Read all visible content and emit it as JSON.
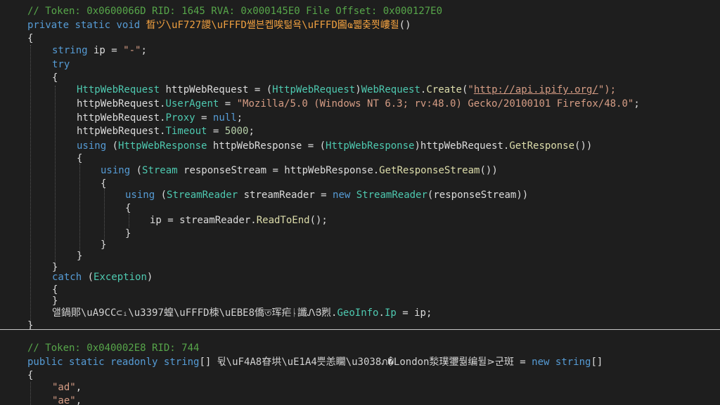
{
  "code": {
    "method_comment": "// Token: 0x0600066D RID: 1645 RVA: 0x000145E0 File Offset: 0x000127E0",
    "kw_private": "private",
    "kw_static": "static",
    "kw_void": "void",
    "method_name": "晳ヅ\\uF727謖\\uFFFD쌜븐켑唉턺욕\\uFFFD\u0011圇ҩ쩳춪쬣嶁죌",
    "method_parens": "()",
    "open_brace": "{",
    "close_brace": "}",
    "kw_string": "string",
    "ip_decl": " ip = ",
    "ip_dash": "\"-\"",
    "semicolon": ";",
    "kw_try": "try",
    "type_httpwebrequest": "HttpWebRequest",
    "var_req": " httpWebRequest = (",
    "cast_close": ")",
    "type_webrequest": "WebRequest",
    "dot": ".",
    "method_create": "Create",
    "open_paren": "(",
    "q_open": "\"",
    "url": "http://api.ipify.org/",
    "q_close_paren_semi": "\");",
    "req_var": "httpWebRequest",
    "prop_useragent": "UserAgent",
    "assign": " = ",
    "useragent_value": "\"Mozilla/5.0 (Windows NT 6.3; rv:48.0) Gecko/20100101 Firefox/48.0\"",
    "prop_proxy": "Proxy",
    "kw_null": "null",
    "prop_timeout": "Timeout",
    "timeout_value": "5000",
    "kw_using": "using",
    "space_paren": " (",
    "type_httpwebresponse": "HttpWebResponse",
    "var_resp": " httpWebResponse = (",
    "cast_close_req": ")httpWebRequest.",
    "method_getresponse": "GetResponse",
    "double_close": "())",
    "type_stream": "Stream",
    "var_stream": " responseStream = httpWebResponse.",
    "method_getresponsestream": "GetResponseStream",
    "type_streamreader": "StreamReader",
    "var_reader": " streamReader = ",
    "kw_new": "new",
    "reader_arg": "(responseStream))",
    "ip_assign": "ip = streamReader.",
    "method_readtoend": "ReadToEnd",
    "call_end": "();",
    "kw_catch": "catch",
    "type_exception": "Exception",
    "obf_class": "앨鍋郥\\uA9CC⊂ᵢ\\u3397蝗\\uFFFD栜\\uEBE8僑ত珲疟ᚿ讖ᏁՅ煭",
    "prop_geoinfo": "GeoInfo",
    "prop_ip": "Ip",
    "ip_end": " = ip;",
    "field_comment": "// Token: 0x040002E8 RID: 744",
    "kw_public": "public",
    "kw_readonly": "readonly",
    "array_brackets": "[] ",
    "field_name": "뒧\\uF4A8昚垬\\uE1A4쁫恙\u0011矙\\u3038ภ�London湬璞瓕뤎编뒬⋗군斑",
    "new_string_arr": "[]",
    "str_ad": "\"ad\"",
    "str_ae": "\"ae\"",
    "comma": ","
  }
}
